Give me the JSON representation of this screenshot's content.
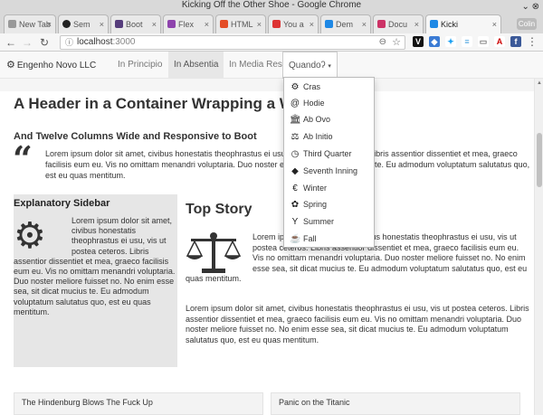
{
  "window": {
    "title": "Kicking Off the Other Shoe - Google Chrome"
  },
  "tabs": [
    {
      "label": "New Tab",
      "color": "#888888"
    },
    {
      "label": "Sem",
      "color": "#222222"
    },
    {
      "label": "Boot",
      "color": "#563d7c"
    },
    {
      "label": "Flex",
      "color": "#8e44ad"
    },
    {
      "label": "HTML",
      "color": "#e44d26"
    },
    {
      "label": "You a",
      "color": "#d33"
    },
    {
      "label": "Dem",
      "color": "#1e88e5"
    },
    {
      "label": "Docu",
      "color": "#cc3366"
    },
    {
      "label": "Kicki",
      "color": "#1e88e5"
    }
  ],
  "window_button": "Colin",
  "address": {
    "host": "localhost",
    "port": ":3000"
  },
  "navbar": {
    "brand": "Engenho Novo LLC",
    "items": [
      "In Principio",
      "In Absentia",
      "In Media Res"
    ],
    "dropdown_label": "Quandoʔ",
    "dropdown_caret": "▾"
  },
  "dropdown": [
    {
      "icon": "⚙",
      "name": "gears-icon",
      "label": "Cras"
    },
    {
      "icon": "@",
      "name": "at-icon",
      "label": "Hodie"
    },
    {
      "icon": "🏛",
      "name": "bank-icon",
      "label": "Ab Ovo"
    },
    {
      "icon": "⚖",
      "name": "balance-icon",
      "label": "Ab Initio"
    },
    {
      "icon": "◷",
      "name": "clock-icon",
      "label": "Third Quarter"
    },
    {
      "icon": "◆",
      "name": "cube-icon",
      "label": "Seventh Inning"
    },
    {
      "icon": "€",
      "name": "euro-icon",
      "label": "Winter"
    },
    {
      "icon": "✿",
      "name": "leaf-icon",
      "label": "Spring"
    },
    {
      "icon": "Y",
      "name": "glass-icon",
      "label": "Summer"
    },
    {
      "icon": "☕",
      "name": "coffee-icon",
      "label": "Fall"
    }
  ],
  "page": {
    "header": "A Header in a Container Wrapping a Wr",
    "subheader": "And Twelve Columns Wide and Responsive to Boot",
    "lead": "Lorem ipsum dolor sit amet, civibus honestatis theophrastus ei usu, vis ut postea ceteros. Libris assentior dissentiet et mea, graeco facilisis eum eu. Vis no omittam menandri voluptaria. Duo noster esse sea, sit dicat mucius te. Eu admodum voluptatum salutatus quo, est eu quas mentitum.",
    "sidebar_title": "Explanatory Sidebar",
    "sidebar_text": "Lorem ipsum dolor sit amet, civibus honestatis theophrastus ei usu, vis ut postea ceteros. Libris assentior dissentiet et mea, graeco facilisis eum eu. Vis no omittam menandri voluptaria. Duo noster meliore fuisset no. No enim esse sea, sit dicat mucius te. Eu admodum voluptatum salutatus quo, est eu quas mentitum.",
    "story_title": "Top Story",
    "story_p1": "Lorem ipsum dolor sit amet, civibus honestatis theophrastus ei usu, vis ut postea ceteros. Libris assentior dissentiet et mea, graeco facilisis eum eu. Vis no omittam menandri voluptaria. Duo noster meliore fuisset no. No enim esse sea, sit dicat mucius te. Eu admodum voluptatum salutatus quo, est eu quas mentitum.",
    "story_p2": "Lorem ipsum dolor sit amet, civibus honestatis theophrastus ei usu, vis ut postea ceteros. Libris assentior dissentiet et mea, graeco facilisis eum eu. Vis no omittam menandri voluptaria. Duo noster meliore fuisset no. No enim esse sea, sit dicat mucius te. Eu admodum voluptatum salutatus quo, est eu quas mentitum.",
    "card1": "The Hindenburg Blows The Fuck Up",
    "card2": "Panic on the Titanic"
  }
}
